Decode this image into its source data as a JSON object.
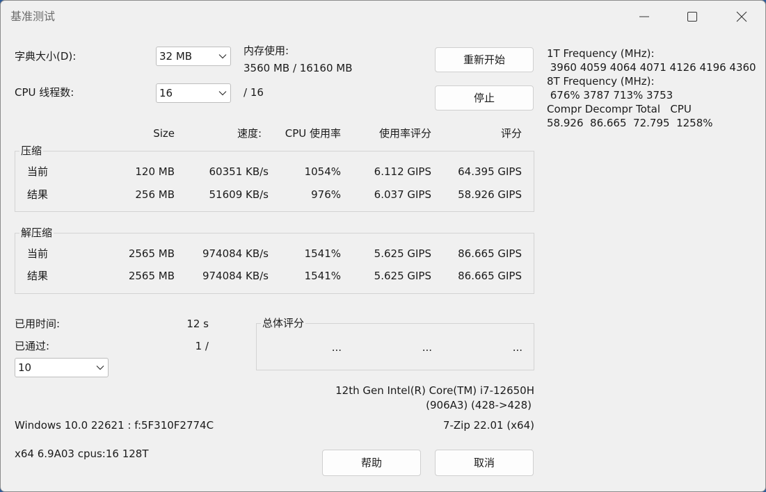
{
  "window": {
    "title": "基准测试"
  },
  "settings": {
    "dict_label": "字典大小(D):",
    "dict_value": "32 MB",
    "threads_label": "CPU 线程数:",
    "threads_value": "16",
    "threads_total": "/ 16",
    "mem_label": "内存使用:",
    "mem_value": "3560 MB / 16160 MB"
  },
  "buttons": {
    "restart": "重新开始",
    "stop": "停止",
    "help": "帮助",
    "cancel": "取消"
  },
  "table": {
    "headers": [
      "Size",
      "速度:",
      "CPU 使用率",
      "使用率评分",
      "评分"
    ],
    "compress": {
      "label": "压缩",
      "rows": [
        {
          "name": "当前",
          "cells": [
            "120 MB",
            "60351 KB/s",
            "1054%",
            "6.112 GIPS",
            "64.395 GIPS"
          ]
        },
        {
          "name": "结果",
          "cells": [
            "256 MB",
            "51609 KB/s",
            "976%",
            "6.037 GIPS",
            "58.926 GIPS"
          ]
        }
      ]
    },
    "decompress": {
      "label": "解压缩",
      "rows": [
        {
          "name": "当前",
          "cells": [
            "2565 MB",
            "974084 KB/s",
            "1541%",
            "5.625 GIPS",
            "86.665 GIPS"
          ]
        },
        {
          "name": "结果",
          "cells": [
            "2565 MB",
            "974084 KB/s",
            "1541%",
            "5.625 GIPS",
            "86.665 GIPS"
          ]
        }
      ]
    }
  },
  "status": {
    "elapsed_label": "已用时间:",
    "elapsed_value": "12 s",
    "passes_label": "已通过:",
    "passes_value": "1 /",
    "passes_select": "10"
  },
  "overall": {
    "label": "总体评分",
    "values": [
      "...",
      "...",
      "..."
    ]
  },
  "info": {
    "cpu_name": "12th Gen Intel(R) Core(TM) i7-12650H",
    "cpu_id": "(906A3) (428->428)",
    "os": "Windows 10.0 22621 :  f:5F310F2774C",
    "version": "7-Zip 22.01 (x64)",
    "arch": "x64 6.9A03 cpus:16 128T"
  },
  "side": {
    "lines": [
      "1T Frequency (MHz):",
      " 3960 4059 4064 4071 4126 4196 4360",
      "8T Frequency (MHz):",
      " 676% 3787 713% 3753",
      "Compr Decompr Total   CPU",
      "58.926  86.665  72.795  1258%"
    ]
  }
}
